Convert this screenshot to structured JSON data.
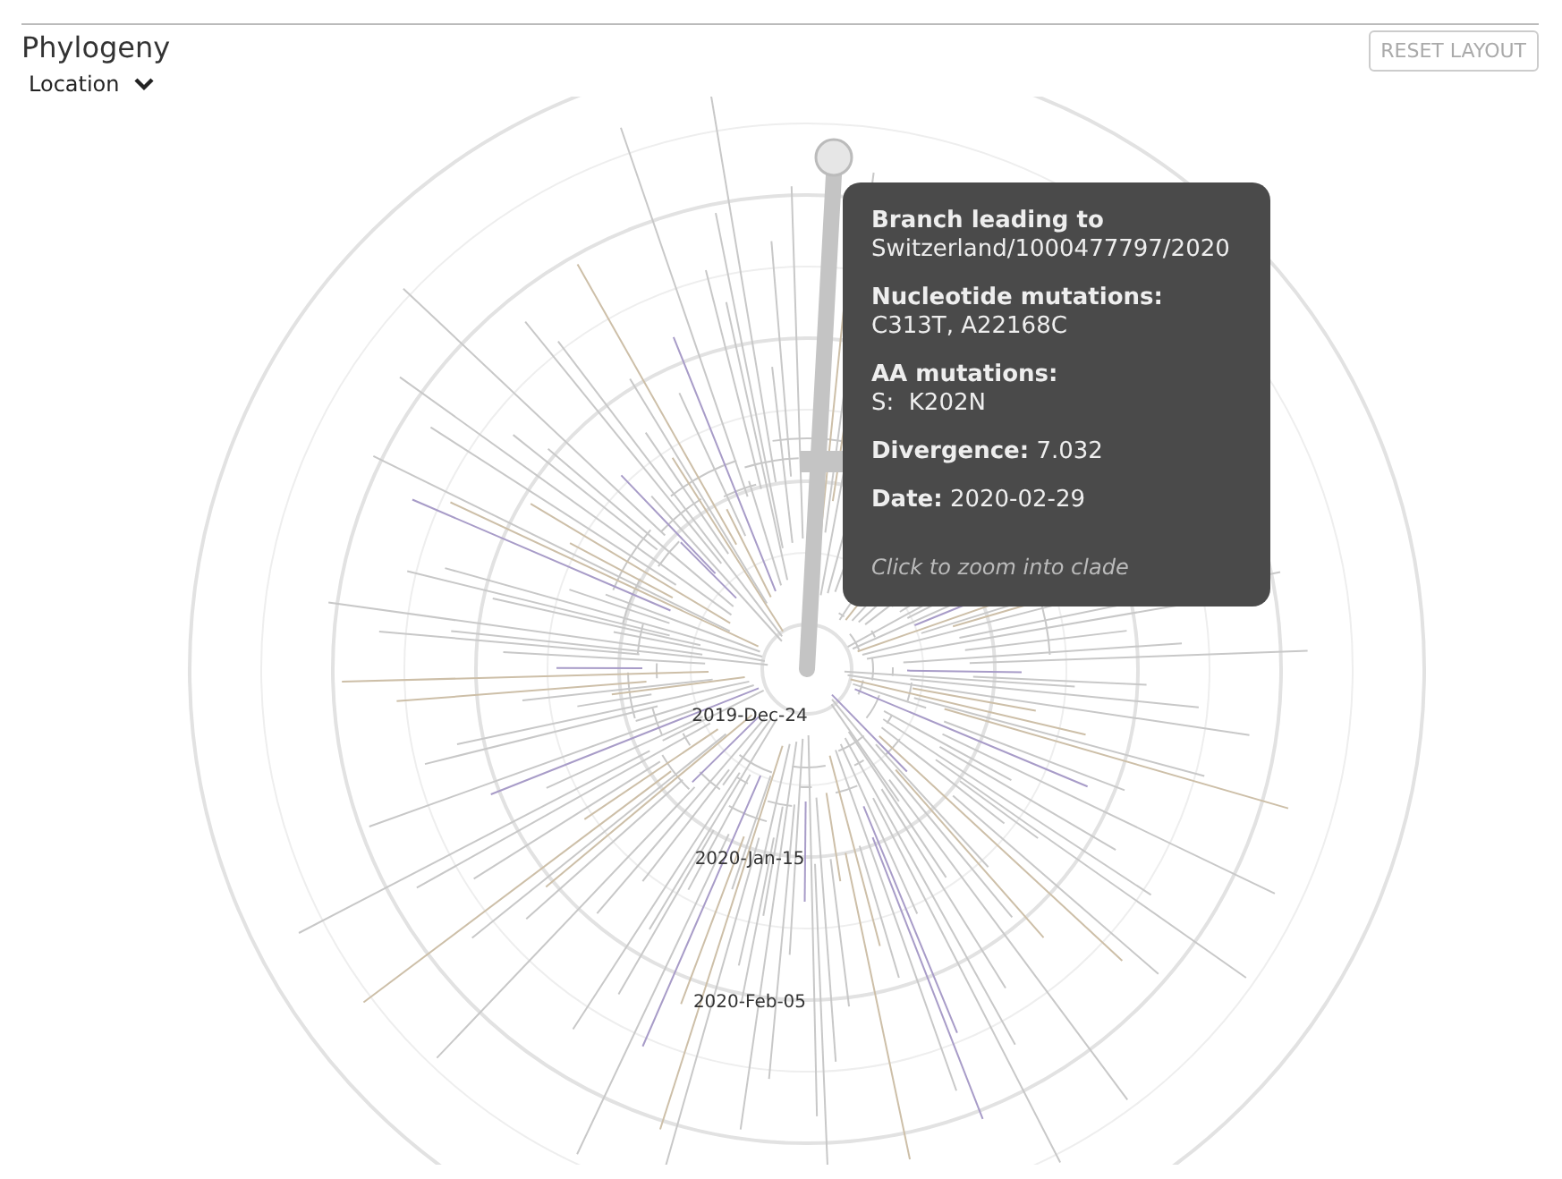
{
  "panel": {
    "title": "Phylogeny",
    "color_by": "Location",
    "reset_button": "RESET LAYOUT"
  },
  "tree": {
    "axis_labels": [
      "2019-Dec-24",
      "2020-Jan-15",
      "2020-Feb-05"
    ]
  },
  "tooltip": {
    "heading": "Branch leading to",
    "strain": "Switzerland/1000477797/2020",
    "fields": [
      {
        "kind": "inline",
        "label": "Nucleotide mutations:",
        "value": "C313T, A22168C"
      },
      {
        "kind": "block",
        "label": "AA mutations:",
        "value": "S:  K202N"
      },
      {
        "kind": "inline",
        "label": "Divergence:",
        "value": "7.032"
      },
      {
        "kind": "inline",
        "label": "Date:",
        "value": "2020-02-29"
      }
    ],
    "hint": "Click to zoom into clade"
  }
}
